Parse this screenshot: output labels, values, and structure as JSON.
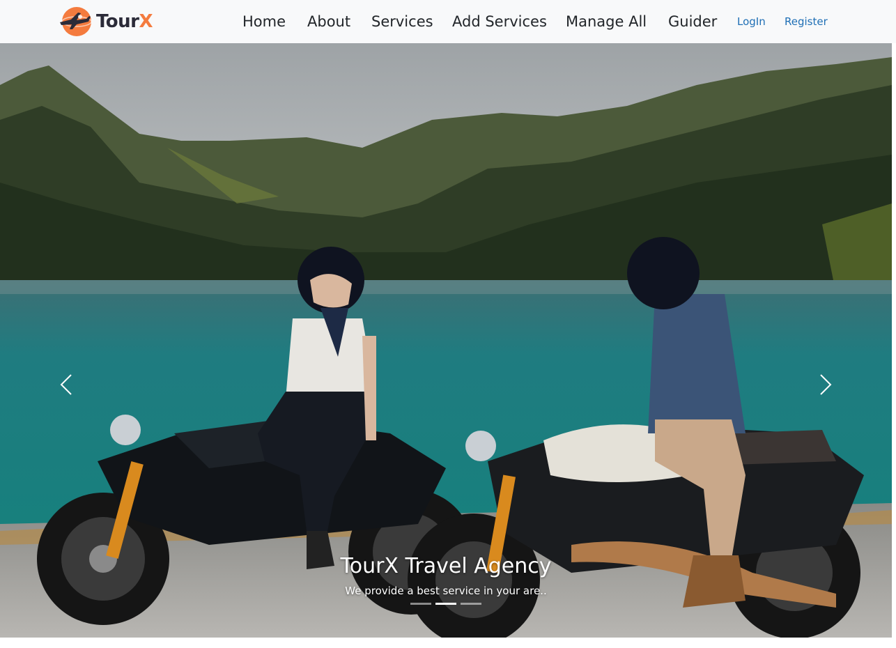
{
  "brand": {
    "name_main": "Tour",
    "name_accent": "X"
  },
  "nav": {
    "links": [
      "Home",
      "About",
      "Services",
      "Add Services",
      "Manage All",
      "Guider"
    ],
    "login": "LogIn",
    "register": "Register"
  },
  "carousel": {
    "title": "TourX Travel Agency",
    "subtitle": "We provide a best service in your are..",
    "slide_count": 3,
    "active_slide": 2
  },
  "colors": {
    "accent": "#f47b3e",
    "nav_bg": "#f8f9fa",
    "link_blue": "#1f6fb5"
  },
  "icons": {
    "prev": "chevron-left-icon",
    "next": "chevron-right-icon",
    "logo": "airplane-globe-icon"
  }
}
